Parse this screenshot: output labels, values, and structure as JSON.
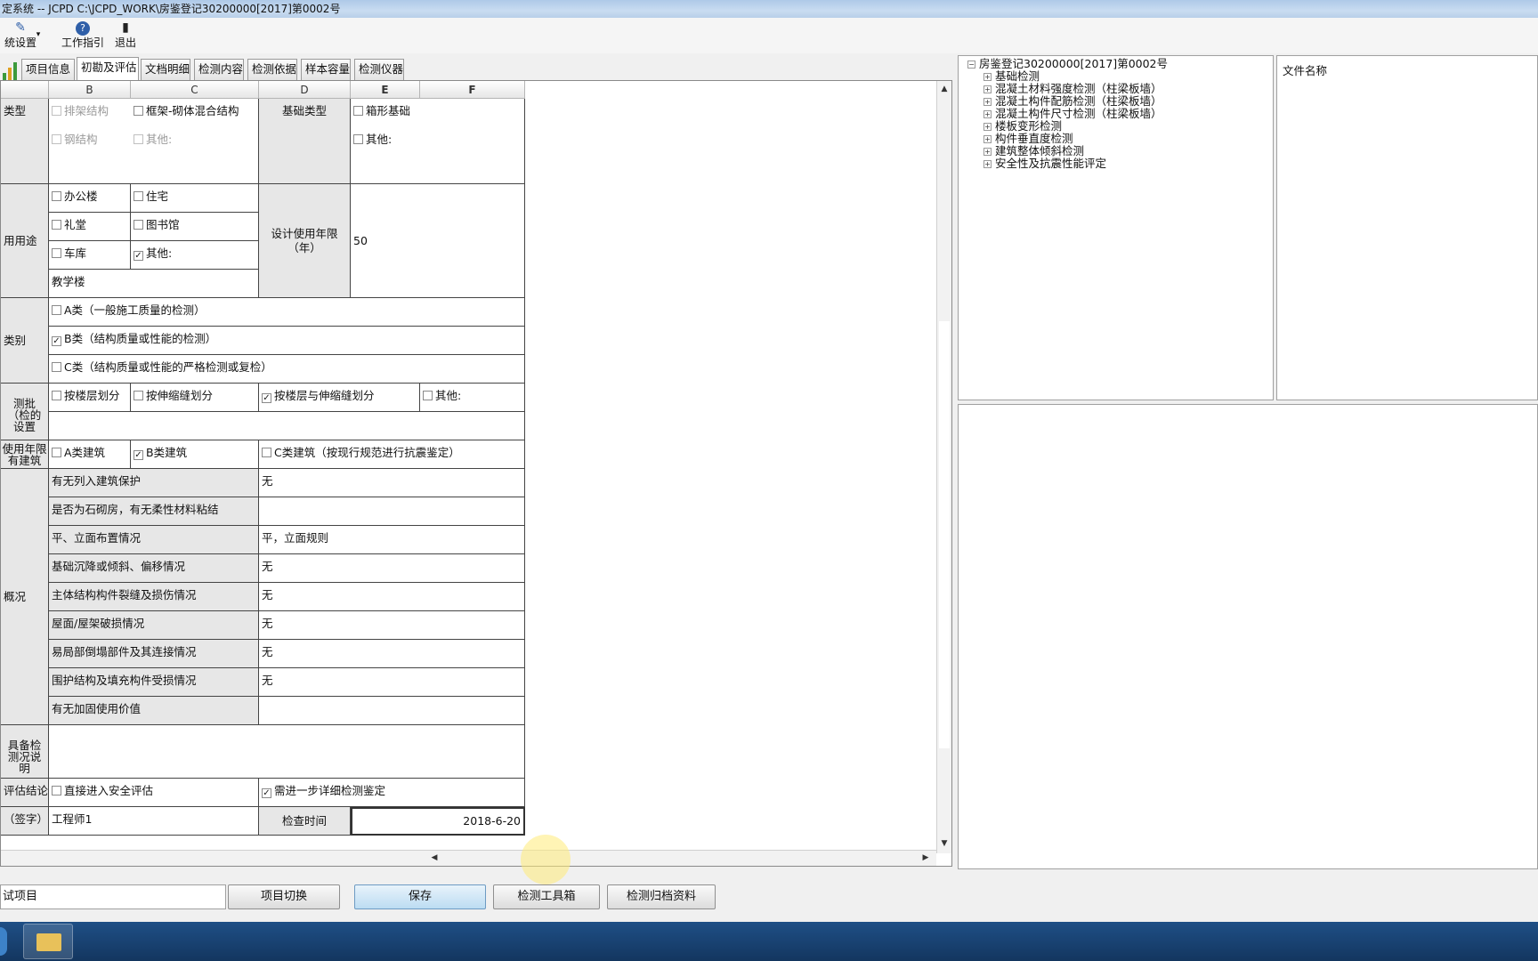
{
  "window": {
    "title": "定系统 -- JCPD  C:\\JCPD_WORK\\房鉴登记30200000[2017]第0002号"
  },
  "toolbar": {
    "settings": "统设置",
    "guide": "工作指引",
    "exit": "退出"
  },
  "tabs": [
    "项目信息",
    "初勘及评估",
    "文档明细",
    "检测内容",
    "检测依据",
    "样本容量",
    "检测仪器"
  ],
  "columns": [
    "B",
    "C",
    "D",
    "E",
    "F"
  ],
  "form": {
    "structure_type": {
      "label": "类型",
      "opt1": "排架结构",
      "opt2": "框架-砌体混合结构",
      "opt3": "钢结构",
      "opt4": "其他:"
    },
    "foundation": {
      "label": "基础类型",
      "opt1": "箱形基础",
      "opt2": "其他:"
    },
    "usage": {
      "label": "用用途",
      "opt1": "办公楼",
      "opt2": "住宅",
      "opt3": "礼堂",
      "opt4": "图书馆",
      "opt5": "车库",
      "opt6": "其他:",
      "other_value": "教学楼"
    },
    "design_life": {
      "label": "设计使用年限（年）",
      "value": "50"
    },
    "category": {
      "label": "类别",
      "a": "A类（一般施工质量的检测）",
      "b": "B类（结构质量或性能的检测）",
      "c": "C类（结构质量或性能的严格检测或复检）"
    },
    "batch": {
      "label": "测批（检的设置",
      "opt1": "按楼层划分",
      "opt2": "按伸缩缝划分",
      "opt3": "按楼层与伸缩缝划分",
      "opt4": "其他:"
    },
    "building_class": {
      "label": "使用年限有建筑",
      "a": "A类建筑",
      "b": "B类建筑",
      "c": "C类建筑（按现行规范进行抗震鉴定）"
    },
    "overview": {
      "label": "概况",
      "rows": [
        {
          "q": "有无列入建筑保护",
          "a": "无"
        },
        {
          "q": "是否为石砌房，有无柔性材料粘结",
          "a": ""
        },
        {
          "q": "平、立面布置情况",
          "a": "平，立面规则"
        },
        {
          "q": "基础沉降或倾斜、偏移情况",
          "a": "无"
        },
        {
          "q": "主体结构构件裂缝及损伤情况",
          "a": "无"
        },
        {
          "q": "屋面/屋架破损情况",
          "a": "无"
        },
        {
          "q": "易局部倒塌部件及其连接情况",
          "a": "无"
        },
        {
          "q": "围护结构及填充构件受损情况",
          "a": "无"
        },
        {
          "q": "有无加固使用价值",
          "a": ""
        }
      ]
    },
    "notes": {
      "label": "具备检测况说明"
    },
    "conclusion": {
      "label": "评估结论",
      "opt1": "直接进入安全评估",
      "opt2": "需进一步详细检测鉴定"
    },
    "signature": {
      "label": "（签字）",
      "value": "工程师1",
      "time_label": "检查时间",
      "time_value": "2018-6-20"
    }
  },
  "tree": {
    "root": "房鉴登记30200000[2017]第0002号",
    "items": [
      "基础检测",
      "混凝土材料强度检测（柱梁板墙）",
      "混凝土构件配筋检测（柱梁板墙）",
      "混凝土构件尺寸检测（柱梁板墙）",
      "楼板变形检测",
      "构件垂直度检测",
      "建筑整体倾斜检测",
      "安全性及抗震性能评定"
    ]
  },
  "files": {
    "header": "文件名称"
  },
  "bottom": {
    "project": "试项目",
    "switch": "项目切换",
    "save": "保存",
    "toolbox": "检测工具箱",
    "archive": "检测归档资料"
  },
  "colors": {
    "accent": "#2f5fa8",
    "taskbar": "#1f4f86"
  }
}
